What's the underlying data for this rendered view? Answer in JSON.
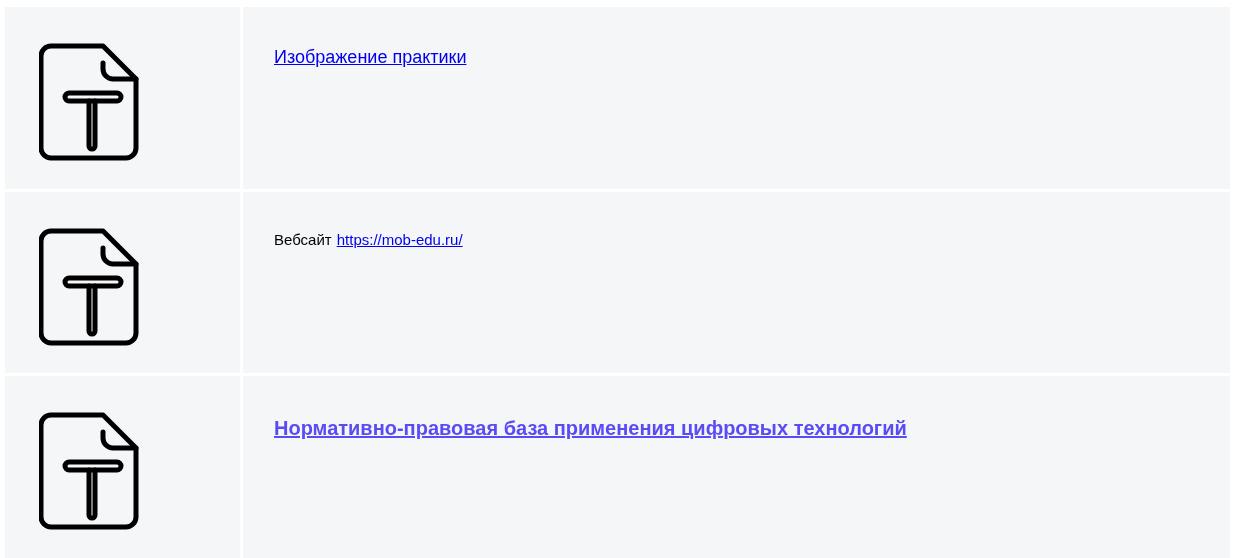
{
  "rows": [
    {
      "kind": "link",
      "link": "Изображение практики"
    },
    {
      "kind": "text_with_link",
      "text": "Вебсайт",
      "link": "https://mob-edu.ru/"
    },
    {
      "kind": "bold_link",
      "link": "Нормативно-правовая база применения цифровых технологий"
    }
  ]
}
